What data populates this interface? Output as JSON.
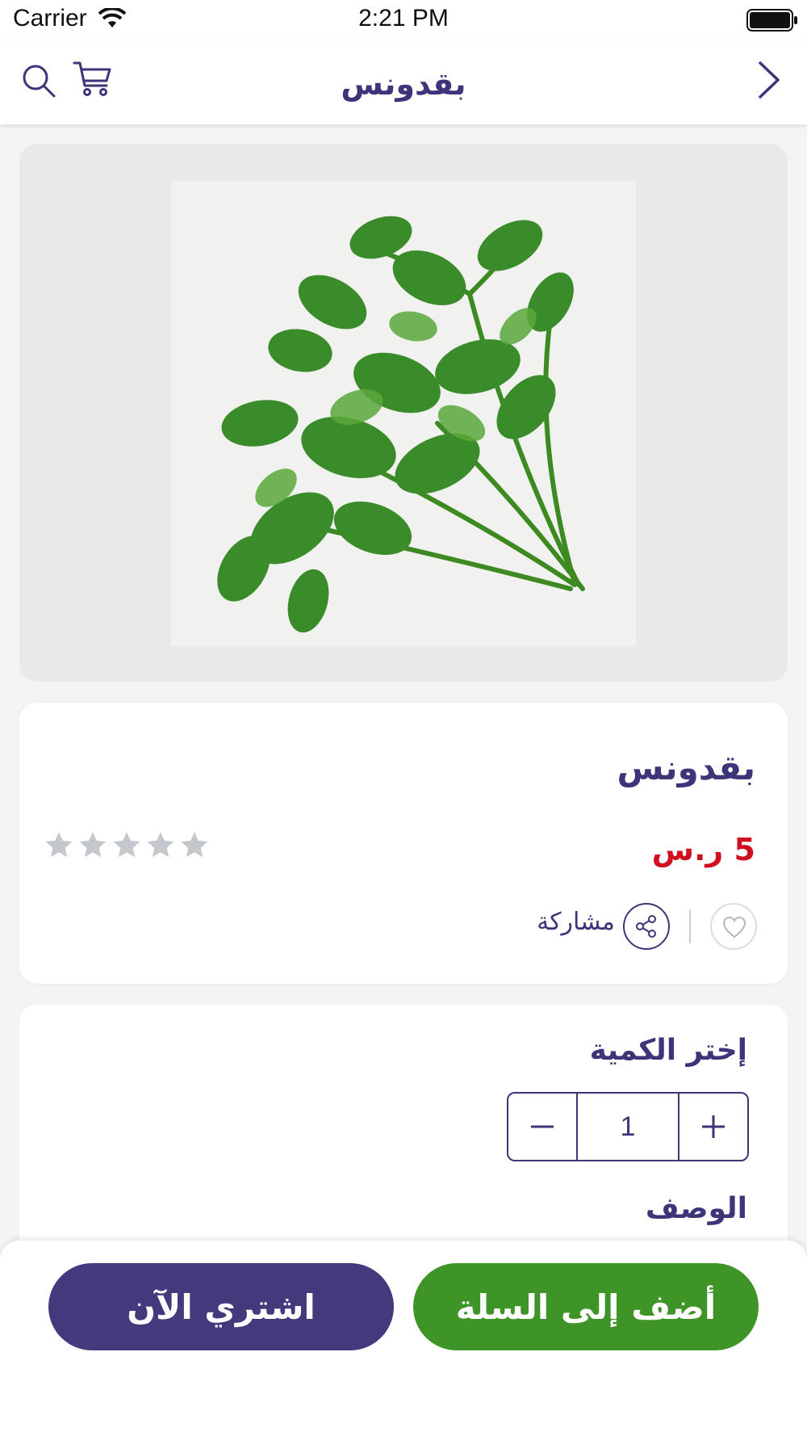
{
  "status_bar": {
    "carrier": "Carrier",
    "time": "2:21 PM"
  },
  "header": {
    "title": "بقدونس",
    "icons": [
      "search-icon",
      "cart-icon",
      "back-chevron-icon"
    ]
  },
  "product": {
    "image_alt": "parsley bunch",
    "name": "بقدونس",
    "price": "5 ر.س",
    "rating": 0,
    "rating_max": 5,
    "share_label": "مشاركة"
  },
  "quantity": {
    "title": "إختر الكمية",
    "value": "1",
    "minus": "−",
    "plus": "+"
  },
  "description": {
    "title": "الوصف"
  },
  "actions": {
    "buy_now": "اشتري الآن",
    "add_to_cart": "أضف إلى السلة"
  },
  "colors": {
    "primary": "#3d3579",
    "price": "#d0101e",
    "add_to_cart": "#3f9427",
    "buy_now": "#433a7d",
    "star_empty": "#c4c7cc"
  }
}
